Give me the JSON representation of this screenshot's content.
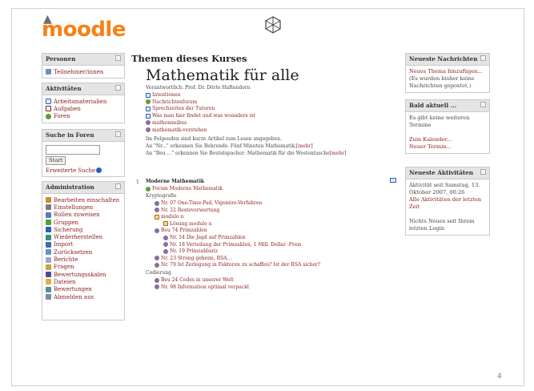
{
  "logo_text": "moodle",
  "page_number": "4",
  "left_blocks": {
    "personen": {
      "title": "Personen",
      "items": [
        {
          "label": "Teilnehmer/innen",
          "icon": "people-icon"
        }
      ]
    },
    "aktivitaeten": {
      "title": "Aktivitäten",
      "items": [
        {
          "label": "Arbeitsmaterialien",
          "icon": "resource-icon"
        },
        {
          "label": "Aufgaben",
          "icon": "assignment-icon"
        },
        {
          "label": "Foren",
          "icon": "forum-icon"
        }
      ]
    },
    "suche": {
      "title": "Suche in Foren",
      "button": "Start",
      "advanced": "Erweiterte Suche"
    },
    "administration": {
      "title": "Administration",
      "items": [
        {
          "label": "Bearbeiten einschalten",
          "icon": "edit-icon"
        },
        {
          "label": "Einstellungen",
          "icon": "settings-icon"
        },
        {
          "label": "Rollen zuweisen",
          "icon": "roles-icon"
        },
        {
          "label": "Gruppen",
          "icon": "groups-icon"
        },
        {
          "label": "Sicherung",
          "icon": "backup-icon"
        },
        {
          "label": "Wiederherstellen",
          "icon": "restore-icon"
        },
        {
          "label": "Import",
          "icon": "import-icon"
        },
        {
          "label": "Zurücksetzen",
          "icon": "reset-icon"
        },
        {
          "label": "Berichte",
          "icon": "reports-icon"
        },
        {
          "label": "Fragen",
          "icon": "questions-icon"
        },
        {
          "label": "Bewertungsskalen",
          "icon": "scales-icon"
        },
        {
          "label": "Dateien",
          "icon": "files-icon"
        },
        {
          "label": "Bewertungen",
          "icon": "grades-icon"
        },
        {
          "label": "Abmelden aus",
          "icon": "unenrol-icon"
        }
      ]
    }
  },
  "main": {
    "heading": "Themen dieses Kurses",
    "course_title": "Mathematik für alle",
    "responsible": "Verantwortlich: Prof. Dr. Dörte Haftendorn",
    "links": [
      {
        "label": "Intentionen",
        "icon": "resource-icon"
      },
      {
        "label": "Nachrichtenforum",
        "icon": "forum-icon"
      },
      {
        "label": "Sprechzeiten der Tutoren",
        "icon": "resource-icon"
      },
      {
        "label": "Was man hier findet und was woanders ist",
        "icon": "resource-icon"
      },
      {
        "label": "mathemmibus",
        "icon": "web-icon"
      },
      {
        "label": "mathematik-verstehen",
        "icon": "web-icon"
      }
    ],
    "intro": "Im Folgenden sind kurze Artikel zum Lesen angegeben.",
    "line_nr": {
      "text": "An \"Nr...\" erkennen Sie Behrends: Fünf Minuten Mathematik, ",
      "more": "[mehr]"
    },
    "line_beu": {
      "text": "An \"Beu ...\" erkennen Sie Beutelspacher: Mathematik für die Westentasche ",
      "more": "[mehr]"
    },
    "section_number": "1",
    "section_title": "Moderne Mathematik",
    "section_forum": "Forum Moderne Mathematik",
    "label_krypto": "Kryptografie",
    "items_a": [
      {
        "label": "Nr. 07 One-Time-Pad, Vigenère-Verfahren",
        "icon": "web-icon",
        "indent": 1
      },
      {
        "label": "Nr. 22 Resteverwertung",
        "icon": "web-icon",
        "indent": 1
      },
      {
        "label": "modulo n",
        "icon": "folder-icon",
        "indent": 1
      },
      {
        "label": "Lösung modulo n",
        "icon": "folder-icon",
        "indent": 2
      },
      {
        "label": "Beu 74 Primzahlen",
        "icon": "web-icon",
        "indent": 1
      },
      {
        "label": "Nr. 54 Die Jagd auf Primzahlen",
        "icon": "web-icon",
        "indent": 2
      },
      {
        "label": "Nr. 18 Verteilung der Primzahlen, 1 Mill. Dollar -Preis",
        "icon": "web-icon",
        "indent": 2
      },
      {
        "label": "Nr. 19 Primzahlsatz",
        "icon": "web-icon",
        "indent": 2
      },
      {
        "label": "Nr. 23 Streng geheim, RSA...",
        "icon": "web-icon",
        "indent": 1
      },
      {
        "label": "Nr. 79 Ist Zerlegung in Faktoren zu schaffen? Ist der RSA sicher?",
        "icon": "web-icon",
        "indent": 1
      }
    ],
    "label_codierung": "Codierung",
    "items_b": [
      {
        "label": "Beu 24 Codes in unserer Welt",
        "icon": "web-icon",
        "indent": 1
      },
      {
        "label": "Nr. 98 Information optimal verpackt",
        "icon": "web-icon",
        "indent": 1
      }
    ]
  },
  "right_blocks": {
    "news": {
      "title": "Neueste Nachrichten",
      "link": "Neues Thema hinzufügen...",
      "text": "(Es wurden bisher keine Nachrichten gepostet.)"
    },
    "upcoming": {
      "title": "Bald aktuell ...",
      "text": "Es gibt keine weiteren Termine",
      "link1": "Zum Kalender...",
      "link2": "Neuer Termin..."
    },
    "activity": {
      "title": "Neueste Aktivitäten",
      "text1": "Aktivität seit Samstag, 13. Oktober 2007, 00:26",
      "link": "Alle Aktivitäten der letzten Zeit",
      "text2": "Nichts Neues seit Ihrem letzten Login"
    }
  },
  "colors": {
    "link": "#8b1a1a",
    "logo": "#f98012",
    "block_header": "#e4e4e4",
    "border": "#c9c9c9"
  }
}
